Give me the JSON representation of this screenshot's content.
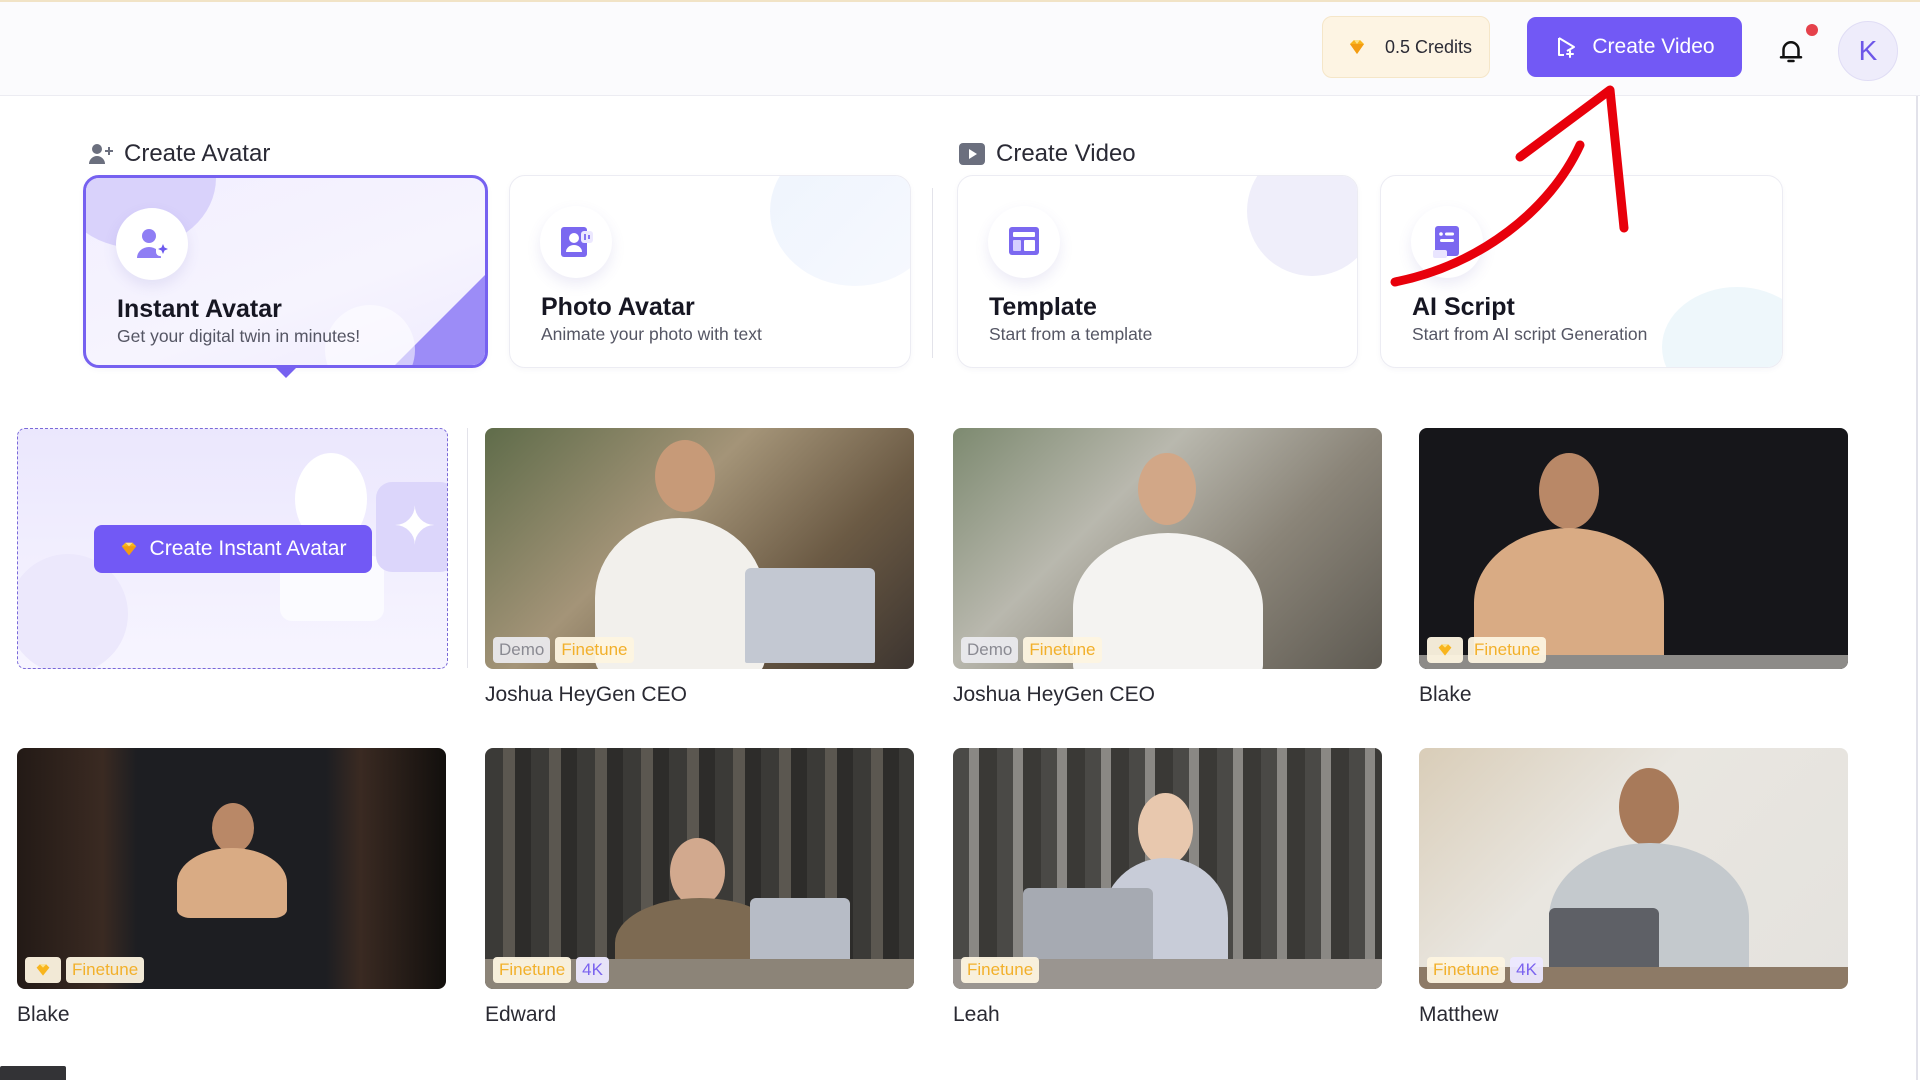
{
  "header": {
    "credits_label": "0.5 Credits",
    "credits_icon": "gem-icon",
    "create_video_label": "Create Video",
    "notifications_icon": "bell-icon",
    "notification_dot": true,
    "user_initial": "K"
  },
  "colors": {
    "accent": "#7259f5",
    "credits_bg": "#fdf4e3",
    "finetune_text": "#f2b02b",
    "badge_4k_text": "#7a62ef",
    "notification": "#e5414b",
    "annotation_arrow": "#e8000b"
  },
  "create_avatar": {
    "section_label": "Create Avatar",
    "cards": [
      {
        "title": "Instant Avatar",
        "subtitle": "Get your digital twin in minutes!",
        "icon": "user-plus-icon",
        "selected": true
      },
      {
        "title": "Photo Avatar",
        "subtitle": "Animate your photo with text",
        "icon": "photo-avatar-icon",
        "selected": false
      }
    ]
  },
  "create_video": {
    "section_label": "Create Video",
    "cards": [
      {
        "title": "Template",
        "subtitle": "Start from a template",
        "icon": "template-icon"
      },
      {
        "title": "AI Script",
        "subtitle": "Start from AI script Generation",
        "icon": "script-icon"
      }
    ]
  },
  "create_instant_avatar": {
    "button_label": "Create Instant Avatar"
  },
  "avatars": [
    {
      "name": "Joshua HeyGen CEO",
      "badges": [
        "Demo",
        "Finetune"
      ]
    },
    {
      "name": "Joshua HeyGen CEO",
      "badges": [
        "Demo",
        "Finetune"
      ]
    },
    {
      "name": "Blake",
      "badges": [
        "gem",
        "Finetune"
      ]
    },
    {
      "name": "Blake",
      "badges": [
        "gem",
        "Finetune"
      ]
    },
    {
      "name": "Edward",
      "badges": [
        "Finetune",
        "4K"
      ]
    },
    {
      "name": "Leah",
      "badges": [
        "Finetune"
      ]
    },
    {
      "name": "Matthew",
      "badges": [
        "Finetune",
        "4K"
      ]
    }
  ],
  "annotation": {
    "type": "hand-drawn-arrow",
    "points_to": "Create Video button"
  }
}
